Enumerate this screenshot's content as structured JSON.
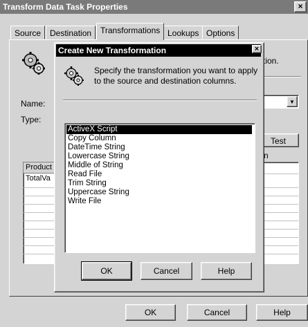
{
  "window": {
    "title": "Transform Data Task Properties",
    "close_glyph": "×"
  },
  "tabs": [
    {
      "label": "Source"
    },
    {
      "label": "Destination"
    },
    {
      "label": "Transformations"
    },
    {
      "label": "Lookups"
    },
    {
      "label": "Options"
    }
  ],
  "active_tab": "Transformations",
  "background": {
    "description_fragment": "tion.",
    "name_label": "Name:",
    "type_label": "Type:",
    "test_button": "Test",
    "column_letter": "n",
    "source_list": {
      "header": "Product",
      "rows": [
        "TotalVa"
      ]
    }
  },
  "main_buttons": {
    "ok": "OK",
    "cancel": "Cancel",
    "help": "Help"
  },
  "dialog": {
    "title": "Create New Transformation",
    "close_glyph": "×",
    "instruction": "Specify the transformation you want to apply to the source and destination columns.",
    "options": [
      "ActiveX Script",
      "Copy Column",
      "DateTime String",
      "Lowercase String",
      "Middle of String",
      "Read File",
      "Trim String",
      "Uppercase String",
      "Write File"
    ],
    "selected_option": "ActiveX Script",
    "buttons": {
      "ok": "OK",
      "cancel": "Cancel",
      "help": "Help"
    }
  },
  "icons": {
    "dialog_icon": "gears-icon",
    "background_icon": "gears-icon"
  },
  "colors": {
    "face": "#d4d4d4",
    "inactive_title": "#7a7a7a",
    "active_title": "#000000",
    "selection": "#000000"
  }
}
